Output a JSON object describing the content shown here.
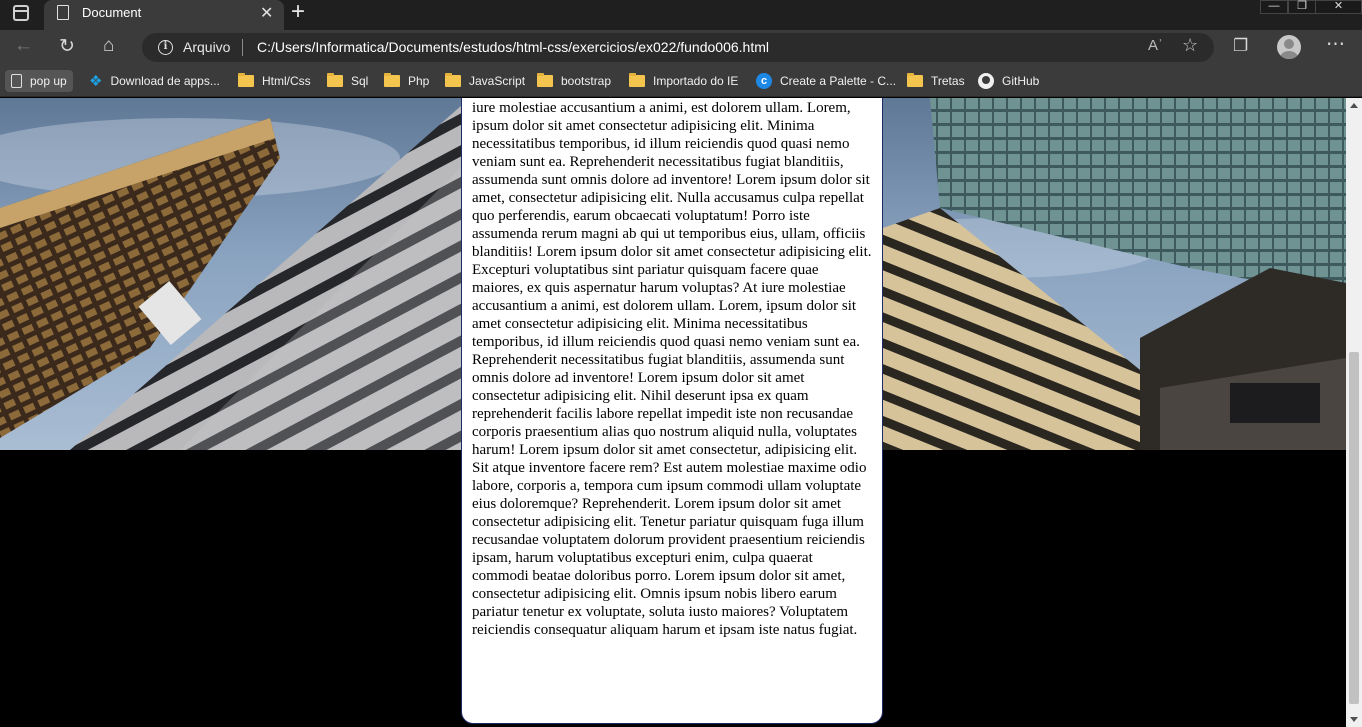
{
  "browser": {
    "tab_title": "Document",
    "tab_close": "✕",
    "new_tab": "+",
    "window_controls": {
      "minimize": "—",
      "restore": "❐",
      "close": "✕"
    },
    "address_scheme": "Arquivo",
    "address_url": "C:/Users/Informatica/Documents/estudos/html-css/exercicios/ex022/fundo006.html",
    "reader_glyph": "Aʾ"
  },
  "bookmarks": [
    {
      "label": "pop up",
      "icon": "page-icon"
    },
    {
      "label": "Download de apps...",
      "icon": "download-app-icon"
    },
    {
      "label": "Html/Css",
      "icon": "folder-icon"
    },
    {
      "label": "Sql",
      "icon": "folder-icon"
    },
    {
      "label": "Php",
      "icon": "folder-icon"
    },
    {
      "label": "JavaScript",
      "icon": "folder-icon"
    },
    {
      "label": "bootstrap",
      "icon": "folder-icon"
    },
    {
      "label": "Importado do IE",
      "icon": "folder-icon"
    },
    {
      "label": "Create a Palette - C...",
      "icon": "coolors-icon"
    },
    {
      "label": "Tretas",
      "icon": "folder-icon"
    },
    {
      "label": "GitHub",
      "icon": "github-icon"
    }
  ],
  "page": {
    "article_text": "iure molestiae accusantium a animi, est dolorem ullam. Lorem, ipsum dolor sit amet consectetur adipisicing elit. Minima necessitatibus temporibus, id illum reiciendis quod quasi nemo veniam sunt ea. Reprehenderit necessitatibus fugiat blanditiis, assumenda sunt omnis dolore ad inventore! Lorem ipsum dolor sit amet, consectetur adipisicing elit. Nulla accusamus culpa repellat quo perferendis, earum obcaecati voluptatum! Porro iste assumenda rerum magni ab qui ut temporibus eius, ullam, officiis blanditiis! Lorem ipsum dolor sit amet consectetur adipisicing elit. Excepturi voluptatibus sint pariatur quisquam facere quae maiores, ex quis aspernatur harum voluptas? At iure molestiae accusantium a animi, est dolorem ullam. Lorem, ipsum dolor sit amet consectetur adipisicing elit. Minima necessitatibus temporibus, id illum reiciendis quod quasi nemo veniam sunt ea. Reprehenderit necessitatibus fugiat blanditiis, assumenda sunt omnis dolore ad inventore! Lorem ipsum dolor sit amet consectetur adipisicing elit. Nihil deserunt ipsa ex quam reprehenderit facilis labore repellat impedit iste non recusandae corporis praesentium alias quo nostrum aliquid nulla, voluptates harum! Lorem ipsum dolor sit amet consectetur, adipisicing elit. Sit atque inventore facere rem? Est autem molestiae maxime odio labore, corporis a, tempora cum ipsum commodi ullam voluptate eius doloremque? Reprehenderit. Lorem ipsum dolor sit amet consectetur adipisicing elit. Tenetur pariatur quisquam fuga illum recusandae voluptatem dolorum provident praesentium reiciendis ipsam, harum voluptatibus excepturi enim, culpa quaerat commodi beatae doloribus porro. Lorem ipsum dolor sit amet, consectetur adipisicing elit. Omnis ipsum nobis libero earum pariatur tenetur ex voluptate, soluta iusto maiores? Voluptatem reiciendis consequatur aliquam harum et ipsam iste natus fugiat.",
    "hero_image": "skyscrapers-photo"
  },
  "colors": {
    "chrome_dark": "#1f1f1f",
    "chrome": "#3b3b3b",
    "address_bar": "#2b2b2b",
    "panel_border": "#1f2a6b",
    "page_background": "#000000",
    "folder": "#f3c44e"
  }
}
